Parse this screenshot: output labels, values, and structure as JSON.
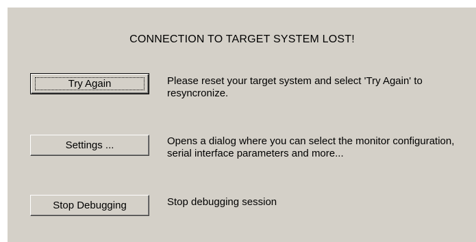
{
  "dialog": {
    "title": "CONNECTION TO TARGET SYSTEM LOST!"
  },
  "actions": [
    {
      "button_label": "Try Again",
      "description": "Please reset your target system and select 'Try Again' to resyncronize."
    },
    {
      "button_label": "Settings ...",
      "description": "Opens a dialog where you can select the monitor configuration, serial interface parameters and more..."
    },
    {
      "button_label": "Stop Debugging",
      "description": "Stop debugging session"
    }
  ],
  "colors": {
    "dialog_background": "#d4d0c8",
    "page_background": "#ffffff",
    "text": "#000000"
  }
}
